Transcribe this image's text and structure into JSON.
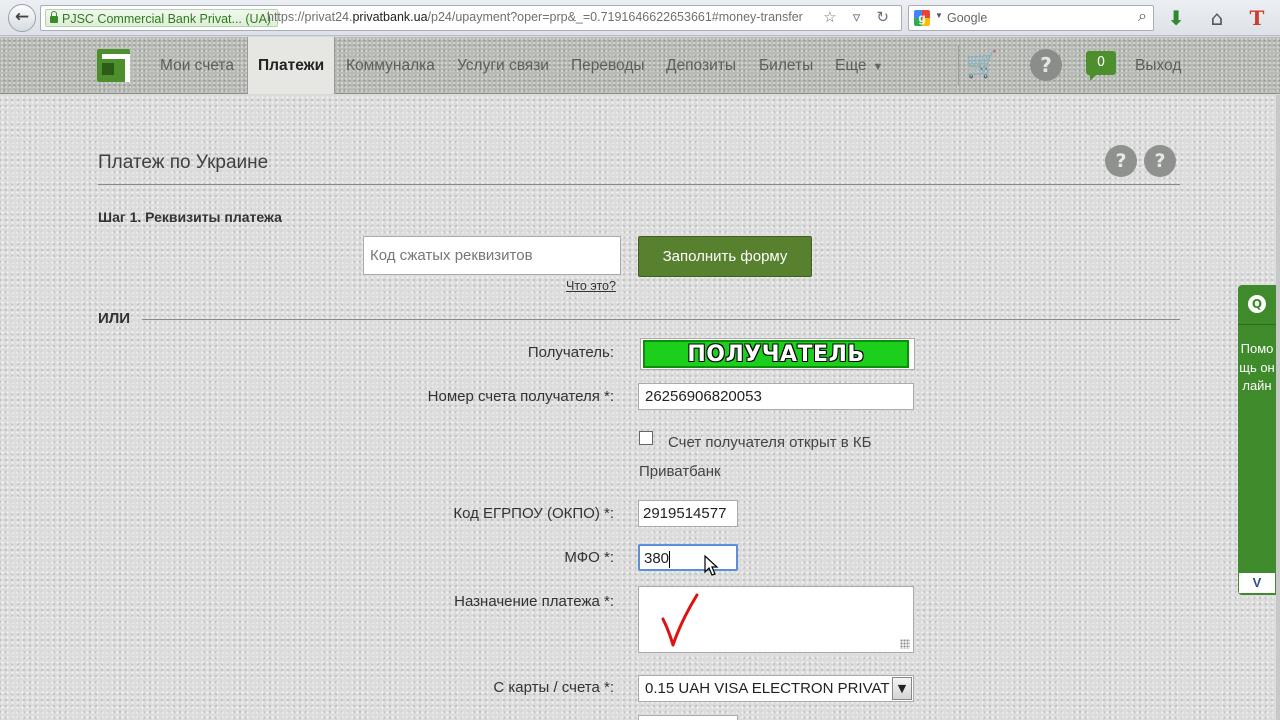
{
  "browser": {
    "back_glyph": "←",
    "site_identity": "PJSC Commercial Bank Privat... (UA)",
    "url_prefix": "https://privat24.",
    "url_domain": "privatbank.ua",
    "url_rest": "/p24/upayment?oper=prp&_=0.7191646622653661#money-transfer",
    "search_placeholder": "Google",
    "url_icons": "☆ ▿ ↻"
  },
  "nav": {
    "items": [
      {
        "label": "Мои счета"
      },
      {
        "label": "Платежи"
      },
      {
        "label": "Коммуналка"
      },
      {
        "label": "Услуги связи"
      },
      {
        "label": "Переводы"
      },
      {
        "label": "Депозиты"
      },
      {
        "label": "Билеты"
      },
      {
        "label": "Еще"
      }
    ],
    "help_glyph": "?",
    "messages_count": "0",
    "logout": "Выход"
  },
  "main": {
    "title": "Платеж по Украине",
    "help_glyph": "?",
    "step_label": "Шаг 1. Реквизиты платежа",
    "code_placeholder": "Код сжатых реквизитов",
    "fill_button": "Заполнить форму",
    "what_is_this": "Что это?",
    "or_label": "ИЛИ"
  },
  "form": {
    "recipient_label": "Получатель:",
    "recipient_banner": "ПОЛУЧАТЕЛЬ",
    "account_label": "Номер счета получателя *:",
    "account_value": "26256906820053",
    "privatbank_checkbox_label": "Счет получателя открыт в КБ Приватбанк",
    "edrpou_label": "Код ЕГРПОУ (ОКПО) *:",
    "edrpou_value": "2919514577",
    "mfo_label": "МФО *:",
    "mfo_value": "380",
    "purpose_label": "Назначение платежа *:",
    "card_label": "С карты / счета *:",
    "card_value": "0.15 UAH   VISA ELECTRON PRIVAT"
  },
  "help_widget": {
    "icon_glyph": "Q",
    "label": "Помощь онлайн",
    "collapse": "V"
  },
  "colors": {
    "brand_green": "#58812f",
    "recipient_highlight": "#1ccf1c",
    "focus_border": "#5b8fd8",
    "checkmark_red": "#e01010"
  }
}
